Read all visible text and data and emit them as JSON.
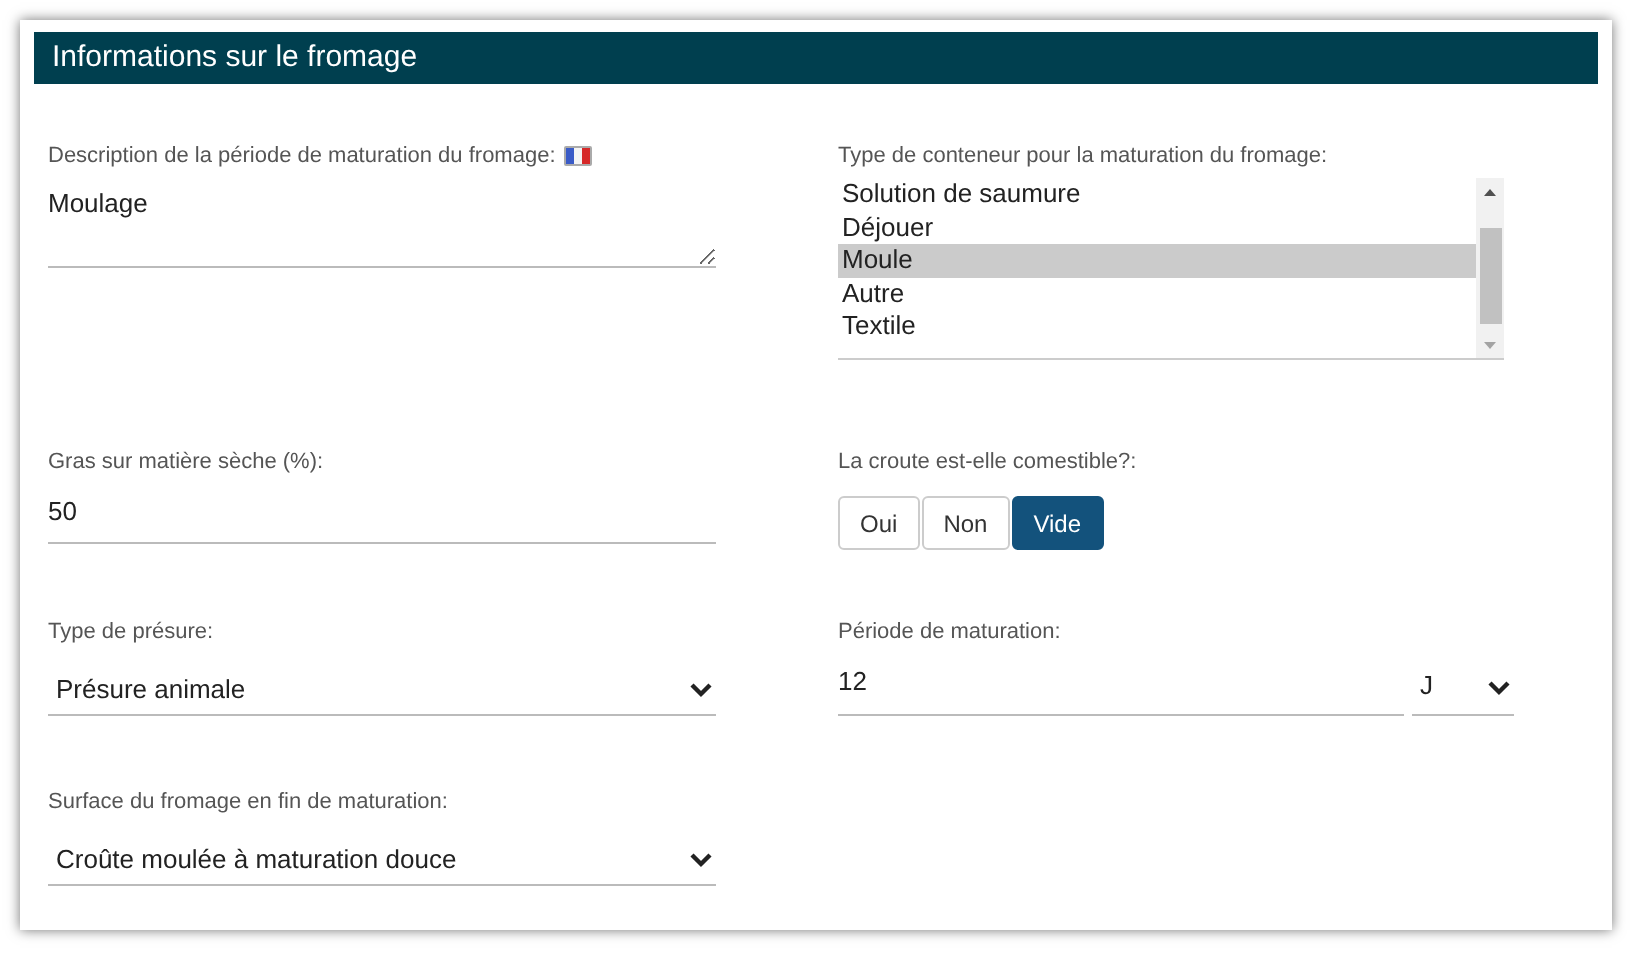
{
  "panel": {
    "title": "Informations sur le fromage"
  },
  "fields": [
    {
      "kind": "textarea",
      "label": "Description de la période de maturation du fromage:",
      "language_flag": true,
      "value": "Moulage"
    },
    {
      "kind": "listbox",
      "label": "Type de conteneur pour la maturation du fromage:",
      "options": [
        {
          "label": "Solution de saumure",
          "selected": false
        },
        {
          "label": "Déjouer",
          "selected": false
        },
        {
          "label": "Moule",
          "selected": true
        },
        {
          "label": "Autre",
          "selected": false
        },
        {
          "label": "Textile",
          "selected": false
        }
      ]
    },
    {
      "kind": "text",
      "label": "Gras sur matière sèche (%):",
      "value": "50"
    },
    {
      "kind": "toggle",
      "label": "La croute est-elle comestible?:",
      "options": [
        {
          "label": "Oui",
          "selected": false
        },
        {
          "label": "Non",
          "selected": false
        },
        {
          "label": "Vide",
          "selected": true
        }
      ]
    },
    {
      "kind": "select",
      "label": "Type de présure:",
      "value": "Présure animale"
    },
    {
      "kind": "number_unit",
      "label": "Période de maturation:",
      "value": "12",
      "unit": "J"
    },
    {
      "kind": "select",
      "label": "Surface du fromage en fin de maturation:",
      "value": "Croûte moulée à maturation douce"
    }
  ]
}
